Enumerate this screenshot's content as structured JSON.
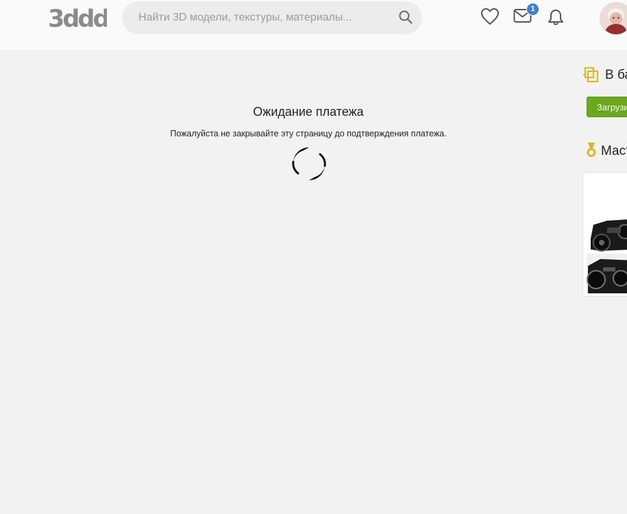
{
  "header": {
    "logo_text": "3ddd",
    "search": {
      "placeholder": "Найти 3D модели, текстуры, материалы...",
      "value": ""
    },
    "messages_badge": "1",
    "icons": [
      "heart-icon",
      "mail-icon",
      "bell-icon",
      "search-icon"
    ]
  },
  "payment": {
    "title": "Ожидание платежа",
    "message": "Пожалуйста не закрывайте эту страницу до подтверждения платежа."
  },
  "sidebar": {
    "cart_label": "В ба",
    "upload_button": "Загрузить",
    "master_label": "Маст"
  },
  "colors": {
    "accent_green": "#6aa81c",
    "badge_blue": "#3f7fd6",
    "icon_gold": "#e2b31a"
  }
}
